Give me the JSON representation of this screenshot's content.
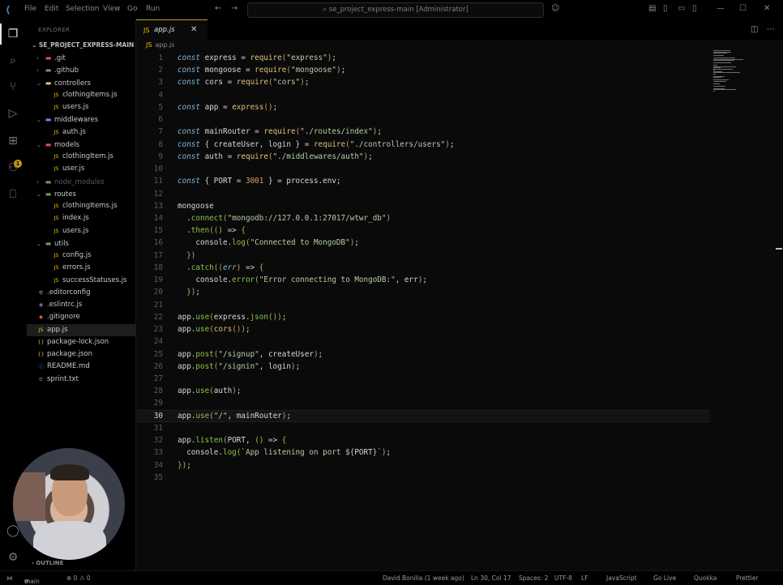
{
  "titlebar": {
    "menu": [
      "File",
      "Edit",
      "Selection",
      "View",
      "Go",
      "Run"
    ],
    "search_text": "se_project_express-main [Administrator]"
  },
  "sidebar": {
    "title": "EXPLORER",
    "root": "SE_PROJECT_EXPRESS-MAIN",
    "items": [
      {
        "label": ".git",
        "depth": 0,
        "type": "folder",
        "chev": "›",
        "icon_color": "#e5534b"
      },
      {
        "label": ".github",
        "depth": 0,
        "type": "folder",
        "chev": "›",
        "icon_color": "#8a8a8a"
      },
      {
        "label": "controllers",
        "depth": 0,
        "type": "folder",
        "chev": "⌄",
        "icon_color": "#e5c07b"
      },
      {
        "label": "clothingItems.js",
        "depth": 1,
        "type": "js"
      },
      {
        "label": "users.js",
        "depth": 1,
        "type": "js"
      },
      {
        "label": "middlewares",
        "depth": 0,
        "type": "folder",
        "chev": "⌄",
        "icon_color": "#6c8ce8"
      },
      {
        "label": "auth.js",
        "depth": 1,
        "type": "js"
      },
      {
        "label": "models",
        "depth": 0,
        "type": "folder",
        "chev": "⌄",
        "icon_color": "#e5534b"
      },
      {
        "label": "clothingItem.js",
        "depth": 1,
        "type": "js"
      },
      {
        "label": "user.js",
        "depth": 1,
        "type": "js"
      },
      {
        "label": "node_modules",
        "depth": 0,
        "type": "folder",
        "chev": "›",
        "icon_color": "#6da34d",
        "dim": true
      },
      {
        "label": "routes",
        "depth": 0,
        "type": "folder",
        "chev": "⌄",
        "icon_color": "#6da34d"
      },
      {
        "label": "clothingItems.js",
        "depth": 1,
        "type": "js"
      },
      {
        "label": "index.js",
        "depth": 1,
        "type": "js"
      },
      {
        "label": "users.js",
        "depth": 1,
        "type": "js"
      },
      {
        "label": "utils",
        "depth": 0,
        "type": "folder",
        "chev": "⌄",
        "icon_color": "#6da34d"
      },
      {
        "label": "config.js",
        "depth": 1,
        "type": "js"
      },
      {
        "label": "errors.js",
        "depth": 1,
        "type": "js"
      },
      {
        "label": "successStatuses.js",
        "depth": 1,
        "type": "js"
      },
      {
        "label": ".editorconfig",
        "depth": 0,
        "type": "cfg"
      },
      {
        "label": ".eslintrc.js",
        "depth": 0,
        "type": "eslint"
      },
      {
        "label": ".gitignore",
        "depth": 0,
        "type": "git"
      },
      {
        "label": "app.js",
        "depth": 0,
        "type": "js",
        "selected": true
      },
      {
        "label": "package-lock.json",
        "depth": 0,
        "type": "json"
      },
      {
        "label": "package.json",
        "depth": 0,
        "type": "json"
      },
      {
        "label": "README.md",
        "depth": 0,
        "type": "md"
      },
      {
        "label": "sprint.txt",
        "depth": 0,
        "type": "txt"
      }
    ],
    "outline": "OUTLINE"
  },
  "editor": {
    "tab_label": "app.js",
    "breadcrumb": "app.js",
    "current_line": 30,
    "lines": [
      [
        [
          "kw",
          "const"
        ],
        [
          "id",
          " express = "
        ],
        [
          "fn",
          "require"
        ],
        [
          "pun",
          "("
        ],
        [
          "str",
          "\"express\""
        ],
        [
          "pun",
          ")"
        ],
        [
          "id",
          ";"
        ]
      ],
      [
        [
          "kw",
          "const"
        ],
        [
          "id",
          " mongoose = "
        ],
        [
          "fn",
          "require"
        ],
        [
          "pun",
          "("
        ],
        [
          "str",
          "\"mongoose\""
        ],
        [
          "pun",
          ")"
        ],
        [
          "id",
          ";"
        ]
      ],
      [
        [
          "kw",
          "const"
        ],
        [
          "id",
          " cors = "
        ],
        [
          "fn",
          "require"
        ],
        [
          "pun",
          "("
        ],
        [
          "str",
          "\"cors\""
        ],
        [
          "pun",
          ")"
        ],
        [
          "id",
          ";"
        ]
      ],
      [],
      [
        [
          "kw",
          "const"
        ],
        [
          "id",
          " app = "
        ],
        [
          "fn",
          "express"
        ],
        [
          "pun",
          "()"
        ],
        [
          "id",
          ";"
        ]
      ],
      [],
      [
        [
          "kw",
          "const"
        ],
        [
          "id",
          " mainRouter = "
        ],
        [
          "fn",
          "require"
        ],
        [
          "pun",
          "("
        ],
        [
          "str",
          "\"./routes/index\""
        ],
        [
          "pun",
          ")"
        ],
        [
          "id",
          ";"
        ]
      ],
      [
        [
          "kw",
          "const"
        ],
        [
          "id",
          " { createUser, login } = "
        ],
        [
          "fn",
          "require"
        ],
        [
          "pun",
          "("
        ],
        [
          "str",
          "\"./controllers/users\""
        ],
        [
          "pun",
          ")"
        ],
        [
          "id",
          ";"
        ]
      ],
      [
        [
          "kw",
          "const"
        ],
        [
          "id",
          " auth = "
        ],
        [
          "fn",
          "require"
        ],
        [
          "pun",
          "("
        ],
        [
          "str",
          "\"./middlewares/auth\""
        ],
        [
          "pun",
          ")"
        ],
        [
          "id",
          ";"
        ]
      ],
      [],
      [
        [
          "kw",
          "const"
        ],
        [
          "id",
          " { PORT = "
        ],
        [
          "num",
          "3001"
        ],
        [
          "id",
          " } = process.env;"
        ]
      ],
      [],
      [
        [
          "id",
          "mongoose"
        ]
      ],
      [
        [
          "id",
          "  ."
        ],
        [
          "prop",
          "connect"
        ],
        [
          "pun",
          "("
        ],
        [
          "str",
          "\"mongodb://127.0.0.1:27017/wtwr_db\""
        ],
        [
          "pun",
          ")"
        ]
      ],
      [
        [
          "id",
          "  ."
        ],
        [
          "prop",
          "then"
        ],
        [
          "pun",
          "(()"
        ],
        [
          "id",
          " => "
        ],
        [
          "pun",
          "{"
        ]
      ],
      [
        [
          "id",
          "    console."
        ],
        [
          "prop",
          "log"
        ],
        [
          "pun",
          "("
        ],
        [
          "str",
          "\"Connected to MongoDB\""
        ],
        [
          "pun",
          ")"
        ],
        [
          "id",
          ";"
        ]
      ],
      [
        [
          "pun",
          "  })"
        ]
      ],
      [
        [
          "id",
          "  ."
        ],
        [
          "prop",
          "catch"
        ],
        [
          "pun",
          "(("
        ],
        [
          "kw",
          "err"
        ],
        [
          "pun",
          ")"
        ],
        [
          "id",
          " => "
        ],
        [
          "pun",
          "{"
        ]
      ],
      [
        [
          "id",
          "    console."
        ],
        [
          "prop",
          "error"
        ],
        [
          "pun",
          "("
        ],
        [
          "str",
          "\"Error connecting to MongoDB:\""
        ],
        [
          "id",
          ", err"
        ],
        [
          "pun",
          ")"
        ],
        [
          "id",
          ";"
        ]
      ],
      [
        [
          "pun",
          "  })"
        ],
        [
          "id",
          ";"
        ]
      ],
      [],
      [
        [
          "id",
          "app."
        ],
        [
          "prop",
          "use"
        ],
        [
          "pun",
          "("
        ],
        [
          "id",
          "express."
        ],
        [
          "prop",
          "json"
        ],
        [
          "pun",
          "())"
        ],
        [
          "id",
          ";"
        ]
      ],
      [
        [
          "id",
          "app."
        ],
        [
          "prop",
          "use"
        ],
        [
          "pun",
          "("
        ],
        [
          "fn",
          "cors"
        ],
        [
          "pun",
          "())"
        ],
        [
          "id",
          ";"
        ]
      ],
      [],
      [
        [
          "id",
          "app."
        ],
        [
          "prop",
          "post"
        ],
        [
          "pun",
          "("
        ],
        [
          "str",
          "\"/signup\""
        ],
        [
          "id",
          ", createUser"
        ],
        [
          "pun",
          ")"
        ],
        [
          "id",
          ";"
        ]
      ],
      [
        [
          "id",
          "app."
        ],
        [
          "prop",
          "post"
        ],
        [
          "pun",
          "("
        ],
        [
          "str",
          "\"/signin\""
        ],
        [
          "id",
          ", login"
        ],
        [
          "pun",
          ")"
        ],
        [
          "id",
          ";"
        ]
      ],
      [],
      [
        [
          "id",
          "app."
        ],
        [
          "prop",
          "use"
        ],
        [
          "pun",
          "("
        ],
        [
          "id",
          "auth"
        ],
        [
          "pun",
          ")"
        ],
        [
          "id",
          ";"
        ]
      ],
      [],
      [
        [
          "id",
          "app."
        ],
        [
          "prop",
          "use"
        ],
        [
          "pun",
          "("
        ],
        [
          "str",
          "\"/\""
        ],
        [
          "id",
          ", mainRouter"
        ],
        [
          "pun",
          ")"
        ],
        [
          "id",
          ";"
        ]
      ],
      [],
      [
        [
          "id",
          "app."
        ],
        [
          "prop",
          "listen"
        ],
        [
          "pun",
          "("
        ],
        [
          "id",
          "PORT, "
        ],
        [
          "pun",
          "()"
        ],
        [
          "id",
          " => "
        ],
        [
          "pun",
          "{"
        ]
      ],
      [
        [
          "id",
          "  console."
        ],
        [
          "prop",
          "log"
        ],
        [
          "pun",
          "("
        ],
        [
          "str",
          "`App listening on port ${"
        ],
        [
          "id",
          "PORT"
        ],
        [
          "str",
          "}`"
        ],
        [
          "pun",
          ")"
        ],
        [
          "id",
          ";"
        ]
      ],
      [
        [
          "pun",
          "})"
        ],
        [
          "id",
          ";"
        ]
      ],
      []
    ]
  },
  "statusbar": {
    "branch": "main",
    "problems": "⊗ 0 ⚠ 0",
    "blame": "David Bonilla (1 week ago)",
    "position": "Ln 30, Col 17",
    "spaces": "Spaces: 2",
    "encoding": "UTF-8",
    "eol": "LF",
    "language": "JavaScript",
    "golive": "Go Live",
    "quokka": "Quokka",
    "prettier": "Prettier"
  },
  "colors": {
    "accent": "#c0a000",
    "js_icon": "#e6c000"
  }
}
